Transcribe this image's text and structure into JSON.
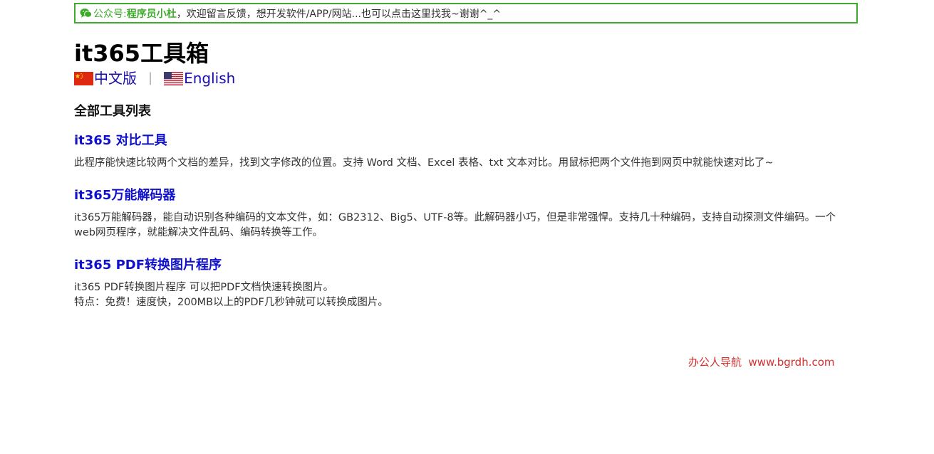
{
  "notice": {
    "label": "公众号: ",
    "name": "程序员小杜",
    "text": "，欢迎留言反馈，想开发软件/APP/网站...也可以点击这里找我~谢谢^_^",
    "icon": "wechat-icon",
    "color": "#3dab2b"
  },
  "page": {
    "title": "it365工具箱"
  },
  "languages": [
    {
      "label": "中文版",
      "icon": "china-flag-icon"
    },
    {
      "label": "English",
      "icon": "us-flag-icon"
    }
  ],
  "languages_separator": "|",
  "section_title": "全部工具列表",
  "tools": [
    {
      "name": "it365 对比工具",
      "desc": [
        "此程序能快速比较两个文档的差异，找到文字修改的位置。支持 Word 文档、Excel 表格、txt 文本对比。用鼠标把两个文件拖到网页中就能快速对比了~"
      ]
    },
    {
      "name": "it365万能解码器",
      "desc": [
        "it365万能解码器，能自动识别各种编码的文本文件，如：GB2312、Big5、UTF-8等。此解码器小巧，但是非常强悍。支持几十种编码，支持自动探测文件编码。一个web网页程序，就能解决文件乱码、编码转换等工作。"
      ]
    },
    {
      "name": "it365 PDF转换图片程序",
      "desc": [
        "it365 PDF转换图片程序 可以把PDF文档快速转换图片。",
        "特点：免费！速度快，200MB以上的PDF几秒钟就可以转换成图片。"
      ]
    }
  ],
  "footer": {
    "text": "办公人导航  www.bgrdh.com",
    "color": "#d32f2f"
  },
  "colors": {
    "link": "#1111cc",
    "accent": "#3dab2b"
  }
}
